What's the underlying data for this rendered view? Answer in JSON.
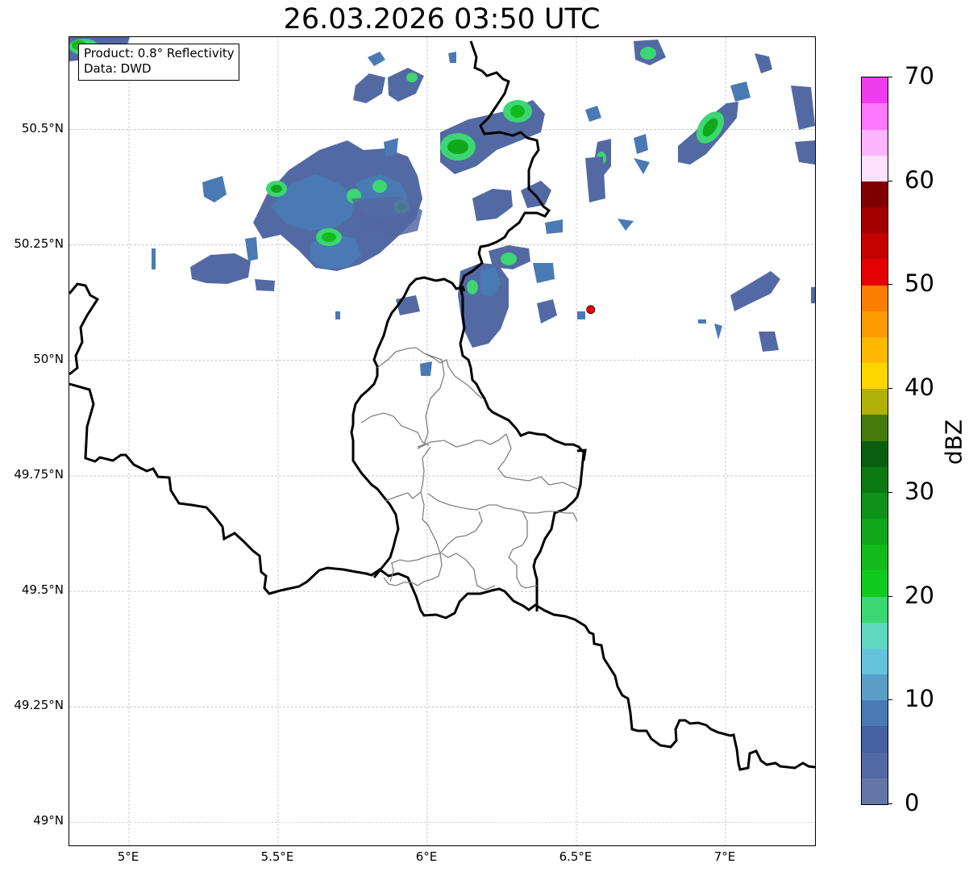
{
  "title": "26.03.2026 03:50 UTC",
  "info": {
    "product": "Product: 0.8° Reflectivity",
    "data": "Data: DWD"
  },
  "map": {
    "lon_range": [
      4.8,
      7.3
    ],
    "lat_range": [
      48.95,
      50.7
    ],
    "grid": true,
    "lat_ticks": [
      {
        "value": 50.5,
        "label": "50.5°N"
      },
      {
        "value": 50.25,
        "label": "50.25°N"
      },
      {
        "value": 50.0,
        "label": "50°N"
      },
      {
        "value": 49.75,
        "label": "49.75°N"
      },
      {
        "value": 49.5,
        "label": "49.5°N"
      },
      {
        "value": 49.25,
        "label": "49.25°N"
      },
      {
        "value": 49.0,
        "label": "49°N"
      }
    ],
    "lon_ticks": [
      {
        "value": 5.0,
        "label": "5°E"
      },
      {
        "value": 5.5,
        "label": "5.5°E"
      },
      {
        "value": 6.0,
        "label": "6°E"
      },
      {
        "value": 6.5,
        "label": "6.5°E"
      },
      {
        "value": 7.0,
        "label": "7°E"
      }
    ],
    "radar_site": {
      "lon": 6.548,
      "lat": 50.11,
      "color": "#ff0000"
    }
  },
  "colorbar": {
    "label": "dBZ",
    "min": 0,
    "max": 70,
    "ticks": [
      "0",
      "10",
      "20",
      "30",
      "40",
      "50",
      "60",
      "70"
    ],
    "colors": [
      "#6475a8",
      "#5369a3",
      "#4660a3",
      "#4a7ab4",
      "#5a9ec8",
      "#63c4dc",
      "#5fd8c0",
      "#3cd672",
      "#12c91e",
      "#11bb1b",
      "#10a71a",
      "#0f9218",
      "#0c7a13",
      "#095f0f",
      "#467a0b",
      "#b0b007",
      "#fdd600",
      "#fdb800",
      "#fc9b00",
      "#fc7e00",
      "#e40000",
      "#c40000",
      "#a40000",
      "#800000",
      "#ffe0ff",
      "#ffb4ff",
      "#ff76ff",
      "#ee3cee"
    ]
  }
}
